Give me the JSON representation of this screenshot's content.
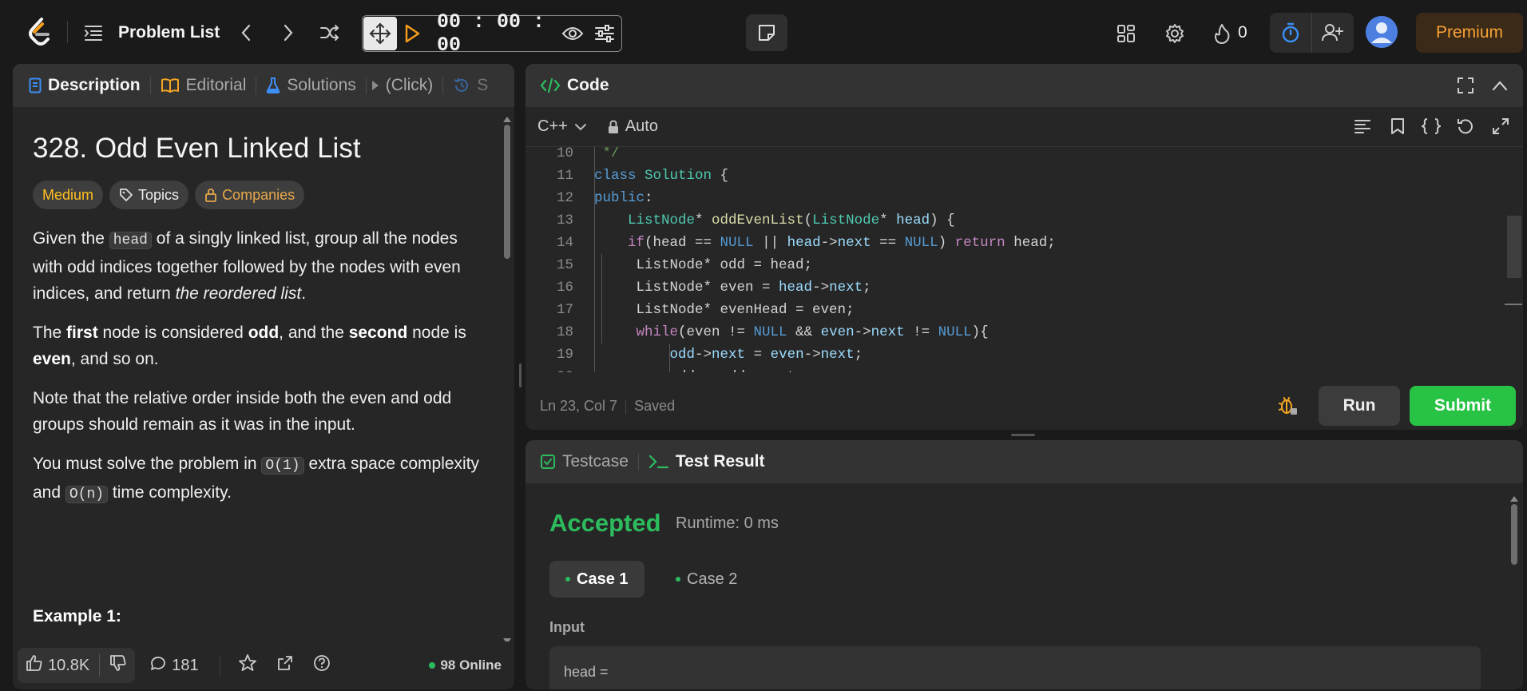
{
  "topbar": {
    "title": "Problem List",
    "timer": "00 : 00 : 00",
    "fire_count": "0",
    "premium_label": "Premium"
  },
  "description": {
    "tabs": [
      {
        "label": "Description",
        "icon": "description-icon"
      },
      {
        "label": "Editorial",
        "icon": "book-icon"
      },
      {
        "label": "Solutions",
        "icon": "flask-icon"
      },
      {
        "label": "(Click)",
        "icon": "play-small-icon"
      },
      {
        "label": "S",
        "icon": "history-icon"
      }
    ],
    "title": "328. Odd Even Linked List",
    "chips": {
      "difficulty": "Medium",
      "topics": "Topics",
      "companies": "Companies"
    },
    "p1": {
      "a": "Given the ",
      "code": "head",
      "b": " of a singly linked list, group all the nodes with odd indices together followed by the nodes with even indices, and return ",
      "em": "the reordered list",
      "c": "."
    },
    "p2": {
      "a": "The ",
      "b1": "first",
      "c": " node is considered ",
      "b2": "odd",
      "d": ", and the ",
      "b3": "second",
      "e": " node is ",
      "b4": "even",
      "f": ", and so on."
    },
    "p3": "Note that the relative order inside both the even and odd groups should remain as it was in the input.",
    "p4": {
      "a": "You must solve the problem in ",
      "code1": "O(1)",
      "b": " extra space complexity and ",
      "code2": "O(n)",
      "c": " time complexity."
    },
    "example": "Example 1:",
    "footer": {
      "likes": "10.8K",
      "comments": "181",
      "online": "98 Online"
    }
  },
  "code": {
    "header": "Code",
    "language": "C++",
    "mode": "Auto",
    "status": {
      "position": "Ln 23, Col 7",
      "saved": "Saved"
    },
    "run_label": "Run",
    "submit_label": "Submit"
  },
  "test": {
    "tabs": {
      "testcase": "Testcase",
      "result": "Test Result"
    },
    "verdict": "Accepted",
    "runtime": "Runtime: 0 ms",
    "cases": [
      "Case 1",
      "Case 2"
    ],
    "input_label": "Input",
    "input_value": "head ="
  }
}
